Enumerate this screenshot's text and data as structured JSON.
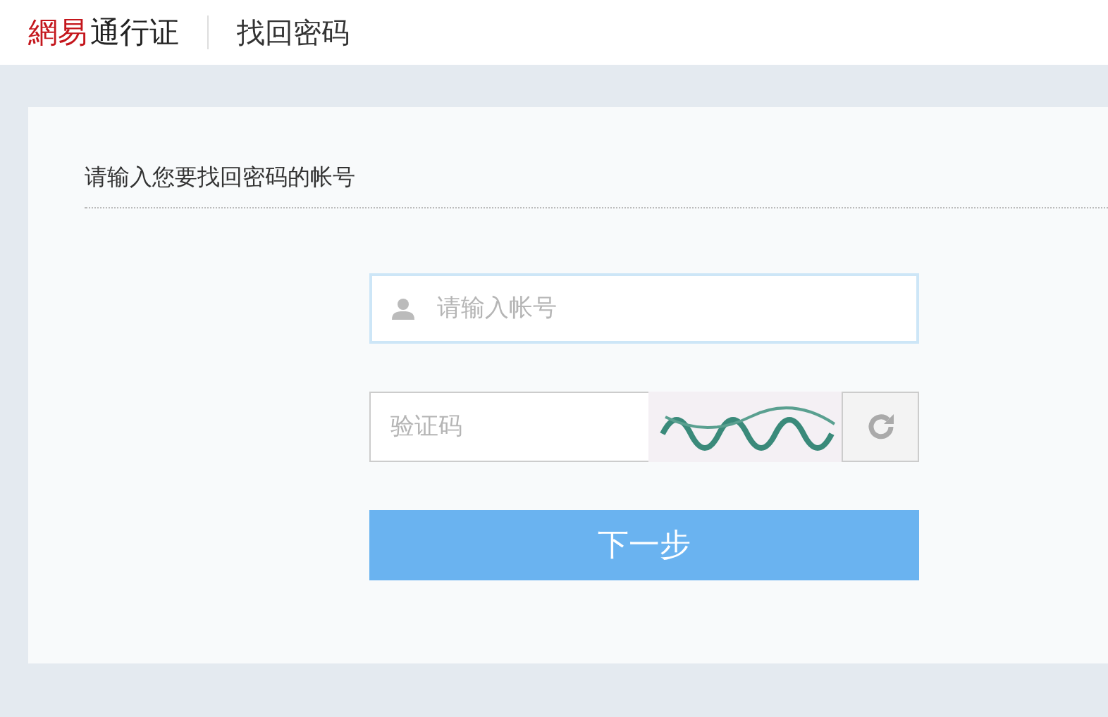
{
  "header": {
    "logo_brand": "網易",
    "logo_product": "通行证",
    "page_title": "找回密码"
  },
  "form": {
    "heading": "请输入您要找回密码的帐号",
    "account": {
      "placeholder": "请输入帐号"
    },
    "captcha": {
      "placeholder": "验证码"
    },
    "submit": "下一步"
  }
}
